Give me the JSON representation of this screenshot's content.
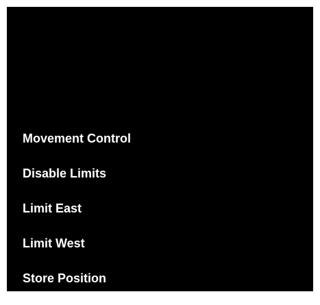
{
  "menu": {
    "items": [
      {
        "label": "Movement Control"
      },
      {
        "label": "Disable Limits"
      },
      {
        "label": "Limit East"
      },
      {
        "label": "Limit West"
      },
      {
        "label": "Store Position"
      }
    ]
  },
  "colors": {
    "background": "#000000",
    "text": "#ffffff",
    "frame": "#ffffff"
  }
}
